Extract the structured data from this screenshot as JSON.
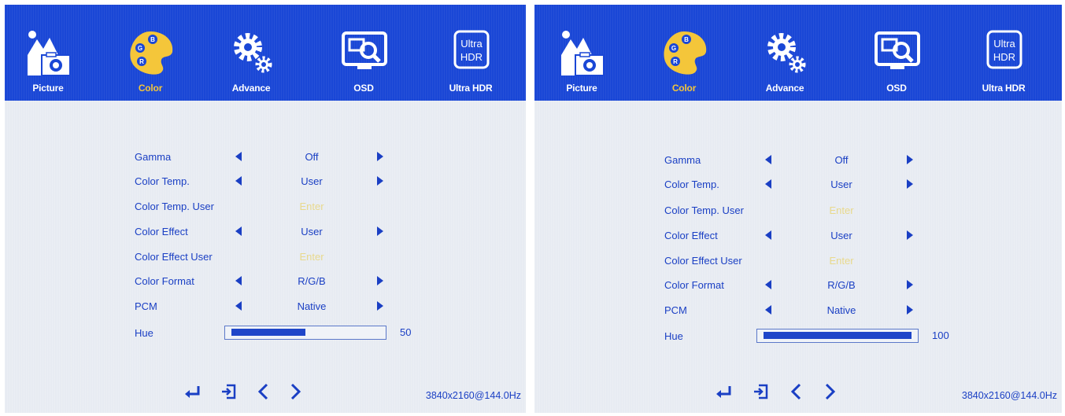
{
  "tabs": [
    "Picture",
    "Color",
    "Advance",
    "OSD",
    "Ultra HDR"
  ],
  "ultra_icon": {
    "line1": "Ultra",
    "line2": "HDR"
  },
  "menu": {
    "gamma": {
      "label": "Gamma",
      "value": "Off"
    },
    "color_temp": {
      "label": "Color Temp.",
      "value": "User"
    },
    "color_temp_user": {
      "label": "Color Temp. User",
      "value": "Enter"
    },
    "color_effect": {
      "label": "Color Effect",
      "value": "User"
    },
    "color_effect_user": {
      "label": "Color Effect User",
      "value": "Enter"
    },
    "color_format": {
      "label": "Color Format",
      "value": "R/G/B"
    },
    "pcm": {
      "label": "PCM",
      "value": "Native"
    },
    "hue": {
      "label": "Hue"
    }
  },
  "screens": {
    "left": {
      "hue_value": "50",
      "hue_fraction": 0.5,
      "resolution": "3840x2160@144.0Hz"
    },
    "right": {
      "hue_value": "100",
      "hue_fraction": 1.0,
      "resolution": "3840x2160@144.0Hz"
    }
  },
  "icons": {
    "picture": "picture-icon",
    "color": "palette-icon",
    "advance": "gears-icon",
    "osd": "monitor-magnifier-icon",
    "ultra_hdr": "ultra-hdr-icon",
    "enter": "enter-arrow-icon",
    "exit": "exit-icon",
    "left": "chevron-left-icon",
    "right": "chevron-right-icon"
  },
  "colors": {
    "header_blue": "#1a47d6",
    "menu_text": "#1a3fc4",
    "active_tab": "#f4c63a",
    "enter_text": "#e8d98c",
    "panel_bg": "#e7ebf2"
  }
}
